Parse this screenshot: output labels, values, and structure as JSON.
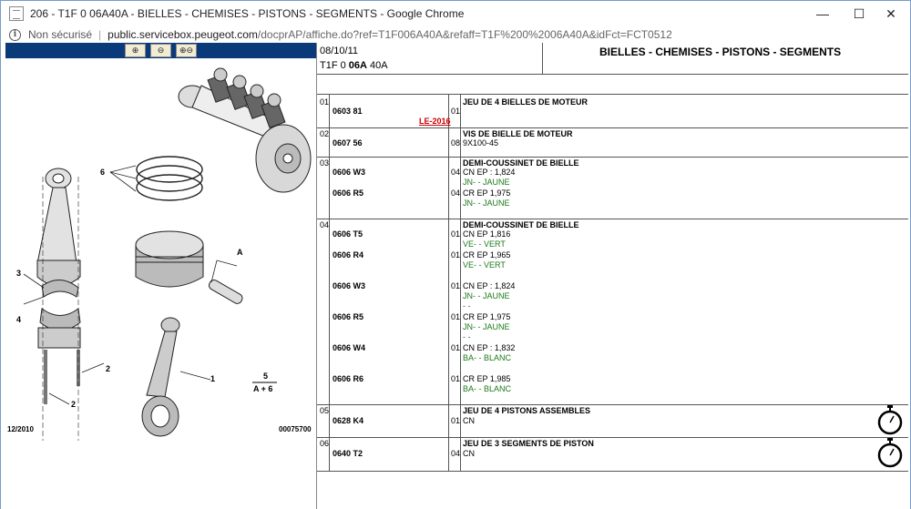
{
  "window": {
    "title": "206 - T1F 0 06A40A - BIELLES - CHEMISES - PISTONS - SEGMENTS - Google Chrome",
    "minimize": "—",
    "maximize": "☐",
    "close": "✕"
  },
  "address_bar": {
    "security": "Non sécurisé",
    "separator": "|",
    "host": "public.servicebox.peugeot.com",
    "path": "/docprAP/affiche.do?ref=T1F006A40A&refaff=T1F%200%2006A40A&idFct=FCT0512"
  },
  "diagram": {
    "zoom_buttons": [
      "⊕",
      "⊖",
      "⊕⊖"
    ],
    "labels": {
      "l6": "6",
      "lA": "A",
      "l3": "3",
      "l4": "4",
      "l1": "1",
      "l2a": "2",
      "l2b": "2",
      "l5": "5",
      "lA6": "A + 6"
    },
    "date": "12/2010",
    "ref": "00075700"
  },
  "header": {
    "date": "08/10/11",
    "code_a": "T1F 0",
    "code_b": "06A",
    "code_c": "40A",
    "title": "BIELLES - CHEMISES - PISTONS - SEGMENTS"
  },
  "rows": [
    {
      "no": "01",
      "parts": [
        {
          "ref": "0603 81",
          "qty": "01",
          "note": "LE-2016"
        }
      ],
      "desc": "JEU DE 4 BIELLES DE MOTEUR",
      "details": []
    },
    {
      "no": "02",
      "parts": [
        {
          "ref": "0607 56",
          "qty": "08"
        }
      ],
      "desc": "VIS DE BIELLE DE MOTEUR",
      "details": [
        "9X100-45"
      ]
    },
    {
      "no": "03",
      "parts": [
        {
          "ref": "0606 W3",
          "qty": "04"
        },
        {
          "ref": "0606 R5",
          "qty": "04"
        }
      ],
      "desc": "DEMI-COUSSINET DE BIELLE",
      "details": [
        "CN EP : 1,824",
        "JN- - JAUNE",
        "CR EP 1,975",
        "JN- - JAUNE"
      ]
    },
    {
      "no": "04",
      "parts": [
        {
          "ref": "0606 T5",
          "qty": "01"
        },
        {
          "ref": "0606 R4",
          "qty": "01"
        },
        {
          "ref": "0606 W3",
          "qty": "01"
        },
        {
          "ref": "0606 R5",
          "qty": "01"
        },
        {
          "ref": "0606 W4",
          "qty": "01"
        },
        {
          "ref": "0606 R6",
          "qty": "01"
        }
      ],
      "desc": "DEMI-COUSSINET DE BIELLE",
      "details": [
        "CN EP 1,816",
        "VE- - VERT",
        "CR EP 1,965",
        "VE- - VERT",
        "CN EP : 1,824",
        "JN- - JAUNE",
        "- -",
        "CR EP 1,975",
        "JN- - JAUNE",
        "- -",
        "CN EP : 1,832",
        "BA- - BLANC",
        "CR EP 1,985",
        "BA- - BLANC"
      ]
    },
    {
      "no": "05",
      "parts": [
        {
          "ref": "0628 K4",
          "qty": "01"
        }
      ],
      "desc": "JEU DE 4 PISTONS ASSEMBLES",
      "details": [
        "CN"
      ],
      "icon": "stopwatch-icon"
    },
    {
      "no": "06",
      "parts": [
        {
          "ref": "0640 T2",
          "qty": "04"
        }
      ],
      "desc": "JEU DE 3 SEGMENTS DE PISTON",
      "details": [
        "CN"
      ],
      "icon": "stopwatch-icon"
    }
  ]
}
